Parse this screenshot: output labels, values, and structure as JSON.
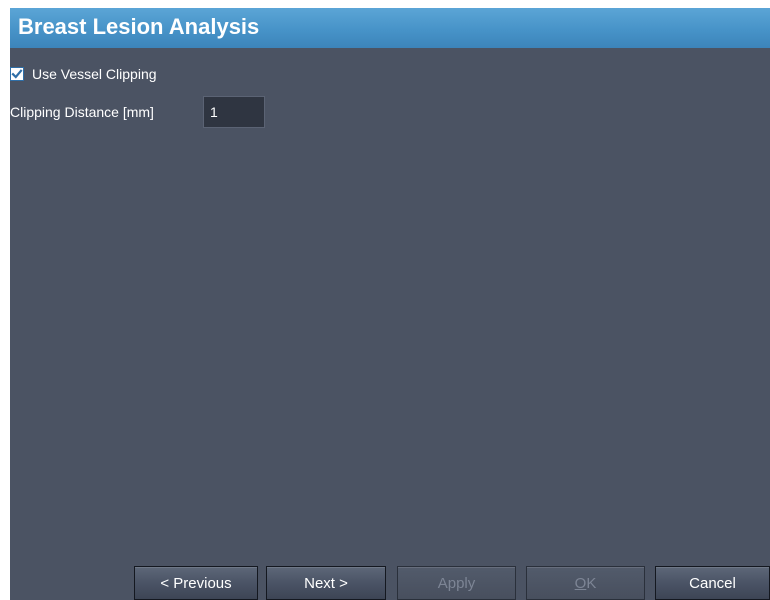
{
  "window": {
    "title": "Breast Lesion Analysis"
  },
  "options": {
    "vessel_clipping": {
      "label": "Use Vessel Clipping",
      "checked": true
    },
    "clipping_distance": {
      "label": "Clipping Distance [mm]",
      "value": "1"
    }
  },
  "footer": {
    "previous_label": "< Previous",
    "next_label": "Next >",
    "apply_label": "Apply",
    "ok_mnemonic": "O",
    "ok_rest": "K",
    "cancel_label": "Cancel"
  },
  "colors": {
    "titlebar": "#4793c8",
    "panel": "#4b5363",
    "input_bg": "#2f3541",
    "checkbox_check": "#2f6fa8"
  },
  "icons": {
    "checkbox": "checkmark-icon"
  }
}
